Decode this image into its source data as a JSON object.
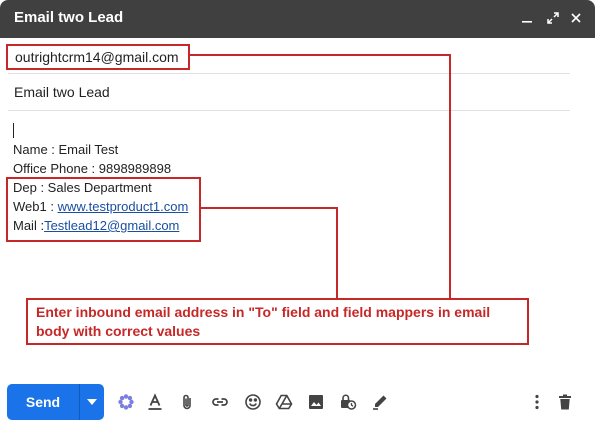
{
  "window": {
    "title": "Email two Lead"
  },
  "compose": {
    "to": "outrightcrm14@gmail.com",
    "subject": "Email two Lead",
    "body": {
      "name_line": "Name : Email Test",
      "phone_line": "Office Phone : 9898989898",
      "dep_line": "Dep : Sales Department",
      "web_label": "Web1 : ",
      "web_link": "www.testproduct1.com",
      "mail_label": "Mail :",
      "mail_link": "Testlead12@gmail.com"
    }
  },
  "annotation": {
    "text": "Enter inbound email address in \"To\" field and field mappers in email body with correct values",
    "color": "#c62828"
  },
  "toolbar": {
    "send_label": "Send",
    "accent": "#1a73e8",
    "icons": [
      "more-send-options-icon",
      "flower-icon",
      "text-format-icon",
      "attach-icon",
      "link-icon",
      "emoji-icon",
      "drive-icon",
      "photo-icon",
      "confidential-mode-icon",
      "signature-icon",
      "more-options-icon",
      "trash-icon"
    ]
  }
}
